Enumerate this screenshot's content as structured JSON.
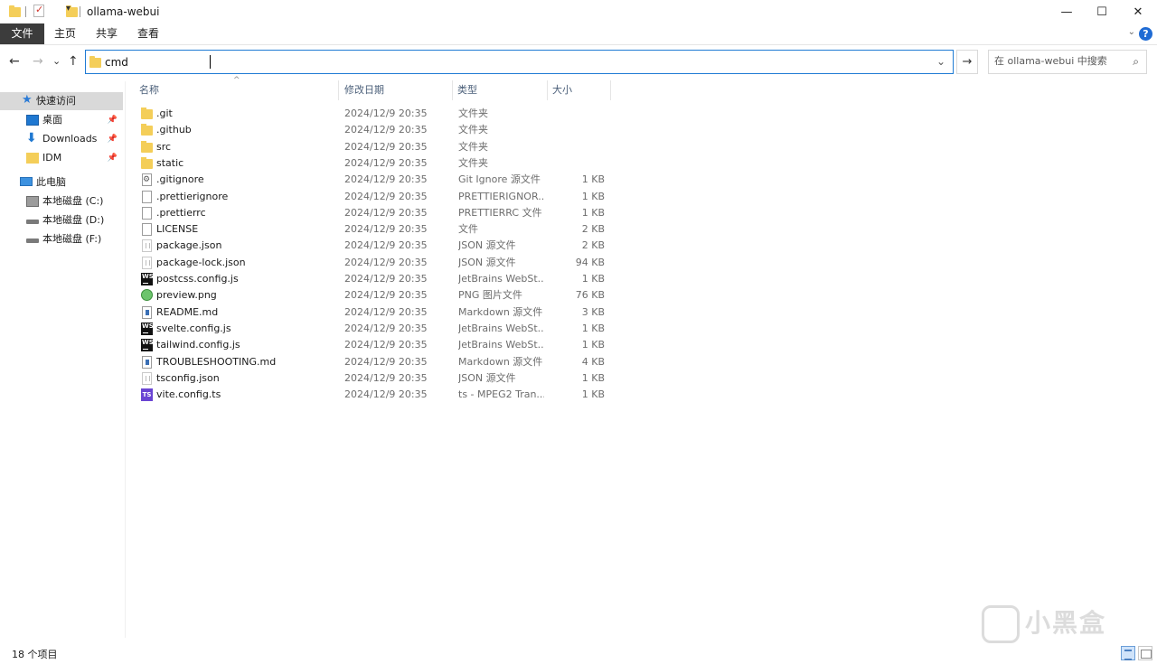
{
  "window": {
    "title": "ollama-webui",
    "minimize": "—",
    "maximize": "☐",
    "close": "✕"
  },
  "ribbon": {
    "tabs": [
      "文件",
      "主页",
      "共享",
      "查看"
    ],
    "collapse_icon": "chevron-down",
    "help": "?"
  },
  "address": {
    "value": "cmd",
    "back": "←",
    "forward": "→",
    "recent": "⌄",
    "up": "↑",
    "go": "→"
  },
  "search": {
    "placeholder": "在 ollama-webui 中搜索"
  },
  "nav": {
    "quick_access": "快速访问",
    "desktop": "桌面",
    "downloads": "Downloads",
    "idm": "IDM",
    "this_pc": "此电脑",
    "drive_c": "本地磁盘 (C:)",
    "drive_d": "本地磁盘 (D:)",
    "drive_f": "本地磁盘 (F:)"
  },
  "columns": {
    "name": "名称",
    "date": "修改日期",
    "type": "类型",
    "size": "大小"
  },
  "files": [
    {
      "name": ".git",
      "date": "2024/12/9 20:35",
      "type": "文件夹",
      "size": "",
      "icon": "folder"
    },
    {
      "name": ".github",
      "date": "2024/12/9 20:35",
      "type": "文件夹",
      "size": "",
      "icon": "folder"
    },
    {
      "name": "src",
      "date": "2024/12/9 20:35",
      "type": "文件夹",
      "size": "",
      "icon": "folder"
    },
    {
      "name": "static",
      "date": "2024/12/9 20:35",
      "type": "文件夹",
      "size": "",
      "icon": "folder"
    },
    {
      "name": ".gitignore",
      "date": "2024/12/9 20:35",
      "type": "Git Ignore 源文件",
      "size": "1 KB",
      "icon": "gear"
    },
    {
      "name": ".prettierignore",
      "date": "2024/12/9 20:35",
      "type": "PRETTIERIGNOR...",
      "size": "1 KB",
      "icon": "doc"
    },
    {
      "name": ".prettierrc",
      "date": "2024/12/9 20:35",
      "type": "PRETTIERRC 文件",
      "size": "1 KB",
      "icon": "doc"
    },
    {
      "name": "LICENSE",
      "date": "2024/12/9 20:35",
      "type": "文件",
      "size": "2 KB",
      "icon": "doc"
    },
    {
      "name": "package.json",
      "date": "2024/12/9 20:35",
      "type": "JSON 源文件",
      "size": "2 KB",
      "icon": "json"
    },
    {
      "name": "package-lock.json",
      "date": "2024/12/9 20:35",
      "type": "JSON 源文件",
      "size": "94 KB",
      "icon": "json"
    },
    {
      "name": "postcss.config.js",
      "date": "2024/12/9 20:35",
      "type": "JetBrains WebSt...",
      "size": "1 KB",
      "icon": "ws"
    },
    {
      "name": "preview.png",
      "date": "2024/12/9 20:35",
      "type": "PNG 图片文件",
      "size": "76 KB",
      "icon": "png"
    },
    {
      "name": "README.md",
      "date": "2024/12/9 20:35",
      "type": "Markdown 源文件",
      "size": "3 KB",
      "icon": "md"
    },
    {
      "name": "svelte.config.js",
      "date": "2024/12/9 20:35",
      "type": "JetBrains WebSt...",
      "size": "1 KB",
      "icon": "ws"
    },
    {
      "name": "tailwind.config.js",
      "date": "2024/12/9 20:35",
      "type": "JetBrains WebSt...",
      "size": "1 KB",
      "icon": "ws"
    },
    {
      "name": "TROUBLESHOOTING.md",
      "date": "2024/12/9 20:35",
      "type": "Markdown 源文件",
      "size": "4 KB",
      "icon": "md"
    },
    {
      "name": "tsconfig.json",
      "date": "2024/12/9 20:35",
      "type": "JSON 源文件",
      "size": "1 KB",
      "icon": "json"
    },
    {
      "name": "vite.config.ts",
      "date": "2024/12/9 20:35",
      "type": "ts - MPEG2 Tran...",
      "size": "1 KB",
      "icon": "ts"
    }
  ],
  "status": {
    "count": "18 个项目"
  },
  "watermark": {
    "text": "小黑盒"
  },
  "colors": {
    "accent": "#1f7bd4",
    "folder": "#f4ce59",
    "selected_nav": "#d9d9d9"
  }
}
